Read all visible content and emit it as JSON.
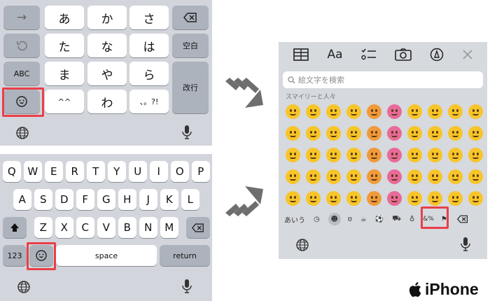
{
  "kana": {
    "row1": [
      "あ",
      "か",
      "さ"
    ],
    "row2": [
      "た",
      "な",
      "は"
    ],
    "row3": [
      "ま",
      "や",
      "ら"
    ],
    "row4": [
      "^^",
      "わ",
      "、。?!"
    ],
    "abc": "ABC",
    "space": "空白",
    "enter": "改行"
  },
  "qwerty": {
    "row1": [
      "Q",
      "W",
      "E",
      "R",
      "T",
      "Y",
      "U",
      "I",
      "O",
      "P"
    ],
    "row2": [
      "A",
      "S",
      "D",
      "F",
      "G",
      "H",
      "J",
      "K",
      "L"
    ],
    "row3": [
      "Z",
      "X",
      "C",
      "V",
      "B",
      "N",
      "M"
    ],
    "num": "123",
    "space": "space",
    "return": "return"
  },
  "emoji_panel": {
    "toolbar_aa": "Aa",
    "search_placeholder": "絵文字を検索",
    "section": "スマイリーと人々",
    "abc_tab": "あいう"
  },
  "brand": "iPhone",
  "colors": {
    "highlight": "#e8404a",
    "keyboard_bg": "#d2d5db",
    "gray_key": "#adb3bc",
    "arrow": "#6e6e6e"
  }
}
